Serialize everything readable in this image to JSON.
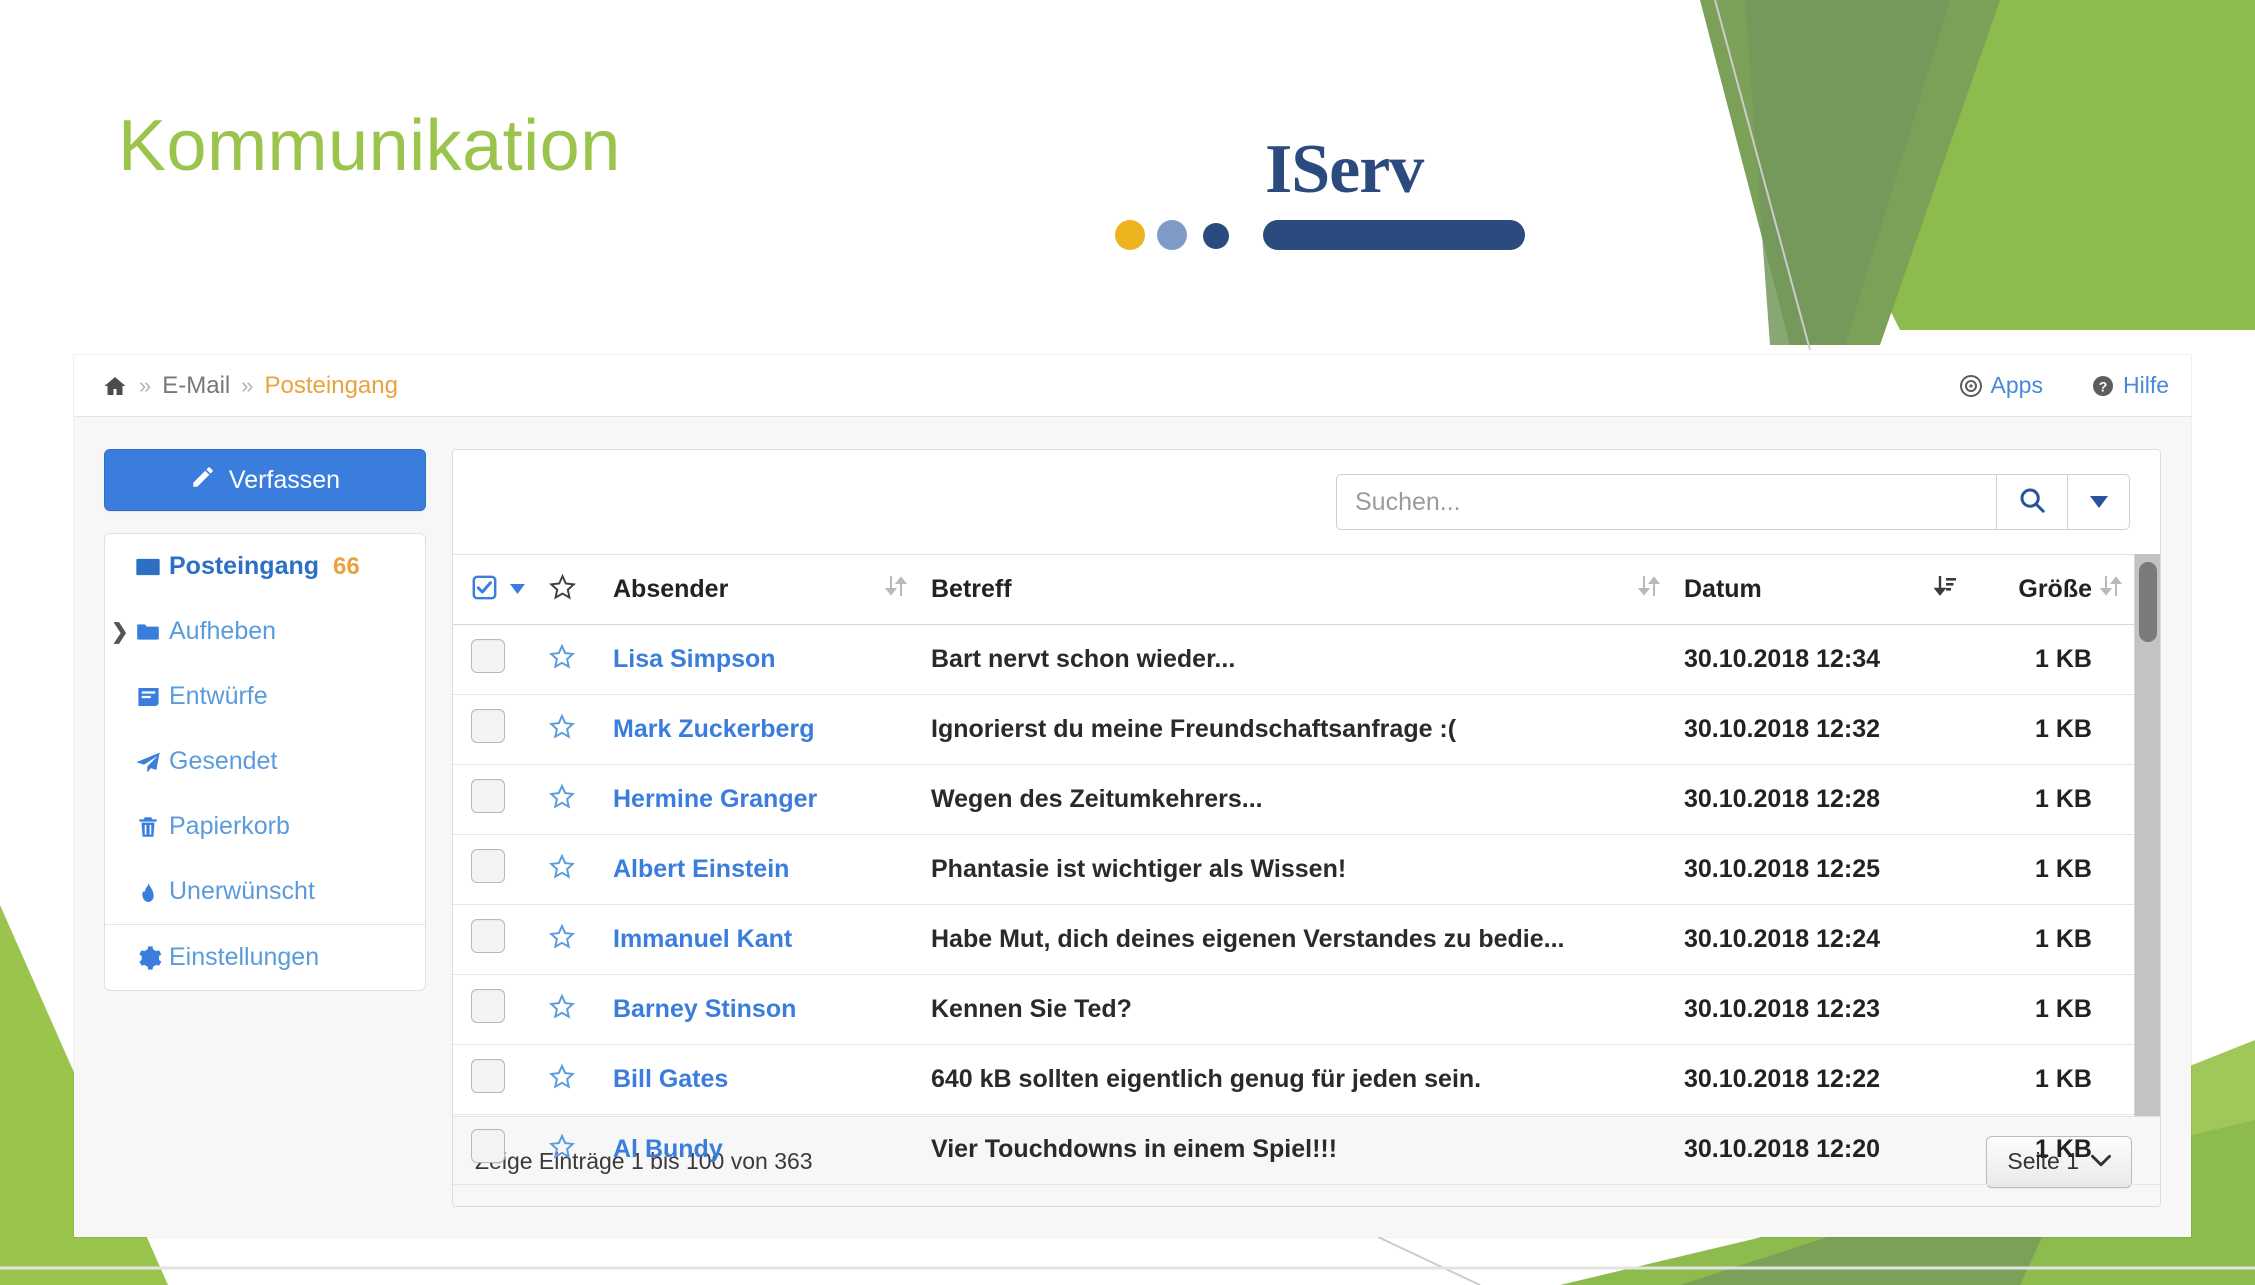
{
  "slide": {
    "title": "Kommunikation",
    "title_color": "#9ac44c"
  },
  "logo": {
    "wordmark": "IServ",
    "dot_colors": [
      "#edb41f",
      "#7f9cc6",
      "#2b4a7d"
    ],
    "bar_color": "#2b4a7d"
  },
  "topbar": {
    "breadcrumb": {
      "home_icon": "home-icon",
      "separator": "»",
      "items": [
        "E-Mail",
        "Posteingang"
      ]
    },
    "apps_label": "Apps",
    "help_label": "Hilfe",
    "apps_icon": "target-circle-icon",
    "help_icon": "question-circle-icon",
    "link_color": "#4a87d8",
    "current_color": "#e8a33d"
  },
  "sidebar": {
    "compose": {
      "label": "Verfassen",
      "icon": "pencil-icon",
      "color": "#3b7ddd"
    },
    "items": [
      {
        "label": "Posteingang",
        "icon": "inbox-icon",
        "badge": "66",
        "active": true,
        "expandable": false
      },
      {
        "label": "Aufheben",
        "icon": "folder-icon",
        "badge": "",
        "active": false,
        "expandable": true
      },
      {
        "label": "Entwürfe",
        "icon": "draft-icon",
        "badge": "",
        "active": false,
        "expandable": false
      },
      {
        "label": "Gesendet",
        "icon": "paper-plane-icon",
        "badge": "",
        "active": false,
        "expandable": false
      },
      {
        "label": "Papierkorb",
        "icon": "trash-icon",
        "badge": "",
        "active": false,
        "expandable": false
      },
      {
        "label": "Unerwünscht",
        "icon": "flame-icon",
        "badge": "",
        "active": false,
        "expandable": false
      }
    ],
    "settings": {
      "label": "Einstellungen",
      "icon": "gear-icon"
    },
    "badge_color": "#e8a33d"
  },
  "search": {
    "placeholder": "Suchen...",
    "value": "",
    "search_icon": "search-icon",
    "caret_icon": "caret-down-icon"
  },
  "table": {
    "select_all_icon": "checkbox-checked-icon",
    "select_all_caret": "caret-down-icon",
    "star_header_icon": "star-icon",
    "columns": [
      {
        "key": "absender",
        "label": "Absender",
        "sort": "none"
      },
      {
        "key": "betreff",
        "label": "Betreff",
        "sort": "none"
      },
      {
        "key": "datum",
        "label": "Datum",
        "sort": "desc"
      },
      {
        "key": "groesse",
        "label": "Größe",
        "sort": "none"
      }
    ],
    "rows": [
      {
        "sender": "Lisa Simpson",
        "subject": "Bart nervt schon wieder...",
        "date": "30.10.2018 12:34",
        "size": "1 KB"
      },
      {
        "sender": "Mark Zuckerberg",
        "subject": "Ignorierst du meine Freundschaftsanfrage :(",
        "date": "30.10.2018 12:32",
        "size": "1 KB"
      },
      {
        "sender": "Hermine Granger",
        "subject": "Wegen des Zeitumkehrers...",
        "date": "30.10.2018 12:28",
        "size": "1 KB"
      },
      {
        "sender": "Albert Einstein",
        "subject": "Phantasie ist wichtiger als Wissen!",
        "date": "30.10.2018 12:25",
        "size": "1 KB"
      },
      {
        "sender": "Immanuel Kant",
        "subject": "Habe Mut, dich deines eigenen Verstandes zu bedie...",
        "date": "30.10.2018 12:24",
        "size": "1 KB"
      },
      {
        "sender": "Barney Stinson",
        "subject": "Kennen Sie Ted?",
        "date": "30.10.2018 12:23",
        "size": "1 KB"
      },
      {
        "sender": "Bill Gates",
        "subject": "640 kB sollten eigentlich genug für jeden sein.",
        "date": "30.10.2018 12:22",
        "size": "1 KB"
      },
      {
        "sender": "Al Bundy",
        "subject": "Vier Touchdowns in einem Spiel!!!",
        "date": "30.10.2018 12:20",
        "size": "1 KB"
      }
    ]
  },
  "footer": {
    "info": "Zeige Einträge 1 bis 100 von 363",
    "page_label": "Seite 1",
    "page_caret_icon": "chevron-down-icon"
  },
  "decor": {
    "green_dark": "#7ba057",
    "green_mid": "#8dbb4e",
    "green_light": "#a0c75a",
    "green_pale": "#9ac44c"
  }
}
